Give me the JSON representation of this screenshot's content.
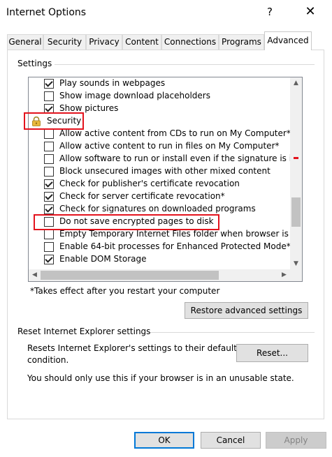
{
  "window": {
    "title": "Internet Options",
    "help_label": "?",
    "close_label": "✕"
  },
  "tabs": [
    {
      "label": "General"
    },
    {
      "label": "Security"
    },
    {
      "label": "Privacy"
    },
    {
      "label": "Content"
    },
    {
      "label": "Connections"
    },
    {
      "label": "Programs"
    },
    {
      "label": "Advanced",
      "active": true
    }
  ],
  "settings": {
    "group_label": "Settings",
    "items_before": [
      {
        "label": "Play sounds in webpages",
        "checked": true
      },
      {
        "label": "Show image download placeholders",
        "checked": false
      },
      {
        "label": "Show pictures",
        "checked": true
      }
    ],
    "category": {
      "label": "Security",
      "icon": "lock-icon"
    },
    "security_items": [
      {
        "label": "Allow active content from CDs to run on My Computer*",
        "checked": false
      },
      {
        "label": "Allow active content to run in files on My Computer*",
        "checked": false
      },
      {
        "label": "Allow software to run or install even if the signature is inv",
        "checked": false
      },
      {
        "label": "Block unsecured images with other mixed content",
        "checked": false
      },
      {
        "label": "Check for publisher's certificate revocation",
        "checked": true
      },
      {
        "label": "Check for server certificate revocation*",
        "checked": true
      },
      {
        "label": "Check for signatures on downloaded programs",
        "checked": true
      },
      {
        "label": "Do not save encrypted pages to disk",
        "checked": false
      },
      {
        "label": "Empty Temporary Internet Files folder when browser is cl",
        "checked": false
      },
      {
        "label": "Enable 64-bit processes for Enhanced Protected Mode*",
        "checked": false
      },
      {
        "label": "Enable DOM Storage",
        "checked": true
      }
    ],
    "scroll_up": "▲",
    "scroll_down": "▼",
    "scroll_left": "◀",
    "scroll_right": "▶",
    "restart_note": "*Takes effect after you restart your computer",
    "restore_button": "Restore advanced settings"
  },
  "reset": {
    "group_label": "Reset Internet Explorer settings",
    "description": [
      "Resets Internet Explorer's settings to their default",
      "condition."
    ],
    "reset_button": "Reset...",
    "note": "You should only use this if your browser is in an unusable state."
  },
  "footer": {
    "ok": "OK",
    "cancel": "Cancel",
    "apply": "Apply"
  },
  "annotation_color": "#e3131d"
}
